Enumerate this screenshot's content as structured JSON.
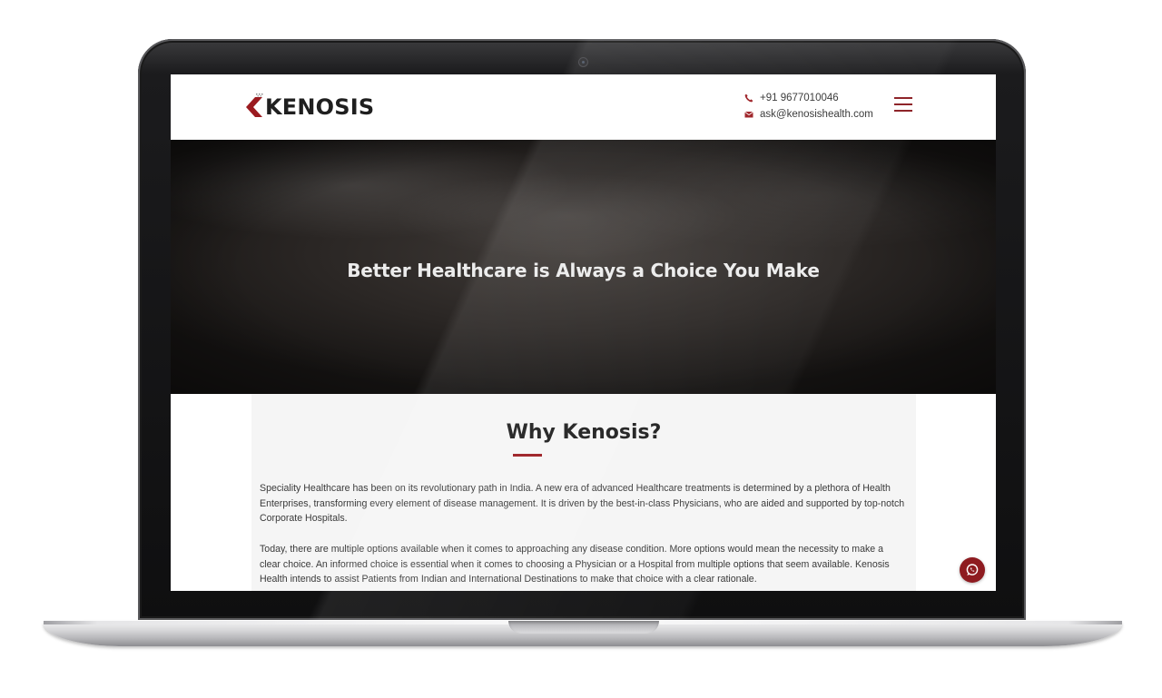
{
  "brand": {
    "name": "KENOSIS",
    "accent_color": "#9b1b20",
    "logo_icon": "kenosis-chevron-logo"
  },
  "header": {
    "phone": "+91 9677010046",
    "email": "ask@kenosishealth.com",
    "phone_icon": "phone-icon",
    "email_icon": "envelope-icon",
    "menu_icon": "hamburger-menu-icon"
  },
  "hero": {
    "title": "Better Healthcare is Always a Choice You Make"
  },
  "why": {
    "title": "Why Kenosis?",
    "paragraphs": [
      "Speciality Healthcare has been on its revolutionary path in India. A new era of advanced Healthcare treatments is determined by a plethora of Health Enterprises, transforming every element of disease management. It is driven by the best-in-class Physicians, who are aided and supported by top-notch Corporate Hospitals.",
      "Today, there are multiple options available when it comes to approaching any disease condition. More options would mean the necessity to make a clear choice. An informed choice is essential when it comes to choosing a Physician or a Hospital from multiple options that seem available. Kenosis Health intends to assist Patients from Indian and International Destinations to make that choice with a clear rationale."
    ]
  },
  "floating": {
    "whatsapp_icon": "whatsapp-icon"
  }
}
